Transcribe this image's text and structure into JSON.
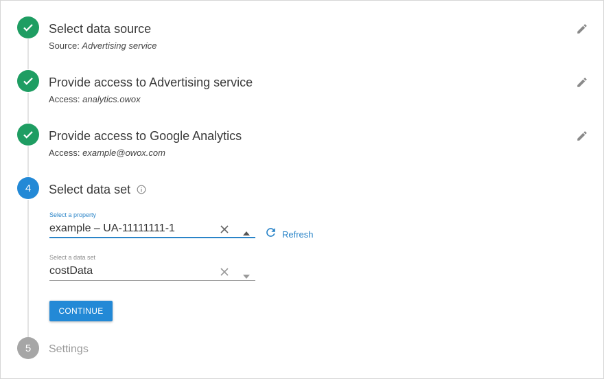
{
  "steps": [
    {
      "number": "1",
      "title": "Select data source",
      "sub_prefix": "Source: ",
      "sub_value": "Advertising service",
      "status": "done"
    },
    {
      "number": "2",
      "title": "Provide access to Advertising service",
      "sub_prefix": "Access: ",
      "sub_value": "analytics.owox",
      "status": "done"
    },
    {
      "number": "3",
      "title": "Provide access to Google Analytics",
      "sub_prefix": "Access: ",
      "sub_value": "example@owox.com",
      "status": "done"
    },
    {
      "number": "4",
      "title": "Select data set",
      "status": "active"
    },
    {
      "number": "5",
      "title": "Settings",
      "status": "pending"
    }
  ],
  "property_field": {
    "label": "Select a property",
    "value": "example – UA-11111111-1"
  },
  "dataset_field": {
    "label": "Select a data set",
    "value": "costData"
  },
  "refresh": {
    "label": "Refresh"
  },
  "continue_button": {
    "label": "CONTINUE"
  },
  "colors": {
    "done": "#1e9d62",
    "active": "#2389d6",
    "pending": "#a6a6a6",
    "link": "#2a84c8"
  },
  "icons": [
    "check-icon",
    "edit-icon",
    "info-icon",
    "clear-icon",
    "caret-up-icon",
    "caret-down-icon",
    "refresh-icon"
  ]
}
